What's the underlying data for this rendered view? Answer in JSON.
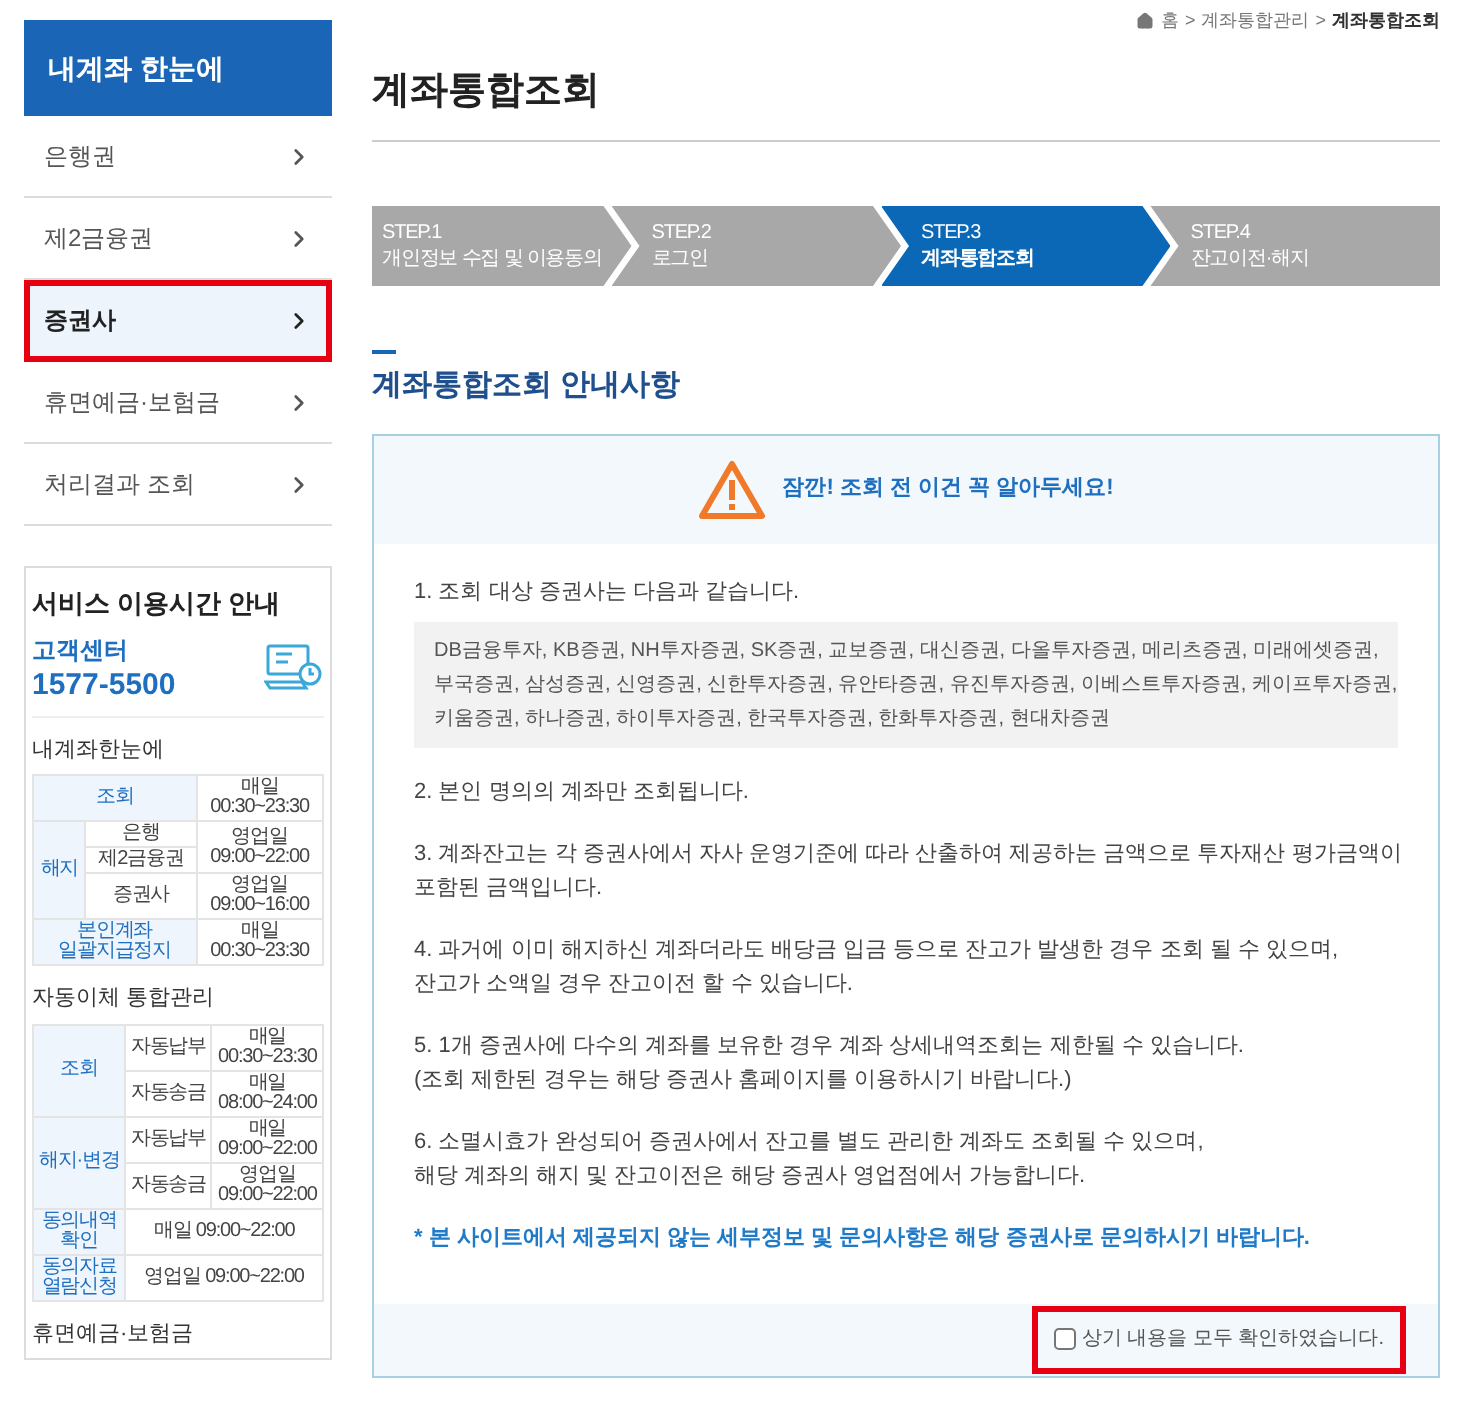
{
  "breadcrumb": [
    {
      "label": "홈",
      "current": false
    },
    {
      "separator": ">",
      "label": "계좌통합관리",
      "current": false
    },
    {
      "separator": ">",
      "label": "계좌통합조회",
      "current": true
    }
  ],
  "sidebar": {
    "title": "내계좌 한눈에",
    "items": [
      {
        "label": "은행권",
        "selected": false,
        "highlighted": false
      },
      {
        "label": "제2금융권",
        "selected": false,
        "highlighted": false
      },
      {
        "label": "증권사",
        "selected": true,
        "highlighted": true
      },
      {
        "label": "휴면예금·보험금",
        "selected": false,
        "highlighted": false
      },
      {
        "label": "처리결과 조회",
        "selected": false,
        "highlighted": false
      }
    ]
  },
  "service_hours": {
    "title": "서비스 이용시간 안내",
    "center_label": "고객센터",
    "center_phone": "1577-5500",
    "sections": [
      {
        "title": "내계좌한눈에",
        "rows": [
          [
            {
              "text": "조회",
              "kind": "head",
              "colspan": 2
            },
            {
              "text": "매일\n00:30~23:30",
              "kind": "value"
            }
          ],
          [
            {
              "text": "해지",
              "kind": "head",
              "rowspan": 3
            },
            {
              "text": "은행",
              "kind": "sub"
            },
            {
              "text": "영업일\n09:00~22:00",
              "kind": "value",
              "rowspan": 2
            }
          ],
          [
            {
              "text": "제2금융권",
              "kind": "sub"
            }
          ],
          [
            {
              "text": "증권사",
              "kind": "sub"
            },
            {
              "text": "영업일\n09:00~16:00",
              "kind": "value"
            }
          ],
          [
            {
              "text": "본인계좌\n일괄지급정지",
              "kind": "head",
              "colspan": 2
            },
            {
              "text": "매일\n00:30~23:30",
              "kind": "value"
            }
          ]
        ]
      },
      {
        "title": "자동이체 통합관리",
        "rows": [
          [
            {
              "text": "조회",
              "kind": "head",
              "rowspan": 2
            },
            {
              "text": "자동납부",
              "kind": "sub"
            },
            {
              "text": "매일\n00:30~23:30",
              "kind": "value"
            }
          ],
          [
            {
              "text": "자동송금",
              "kind": "sub"
            },
            {
              "text": "매일\n08:00~24:00",
              "kind": "value"
            }
          ],
          [
            {
              "text": "해지·변경",
              "kind": "head",
              "rowspan": 2
            },
            {
              "text": "자동납부",
              "kind": "sub"
            },
            {
              "text": "매일\n09:00~22:00",
              "kind": "value"
            }
          ],
          [
            {
              "text": "자동송금",
              "kind": "sub"
            },
            {
              "text": "영업일\n09:00~22:00",
              "kind": "value"
            }
          ],
          [
            {
              "text": "동의내역\n확인",
              "kind": "head"
            },
            {
              "text": "매일 09:00~22:00",
              "kind": "value",
              "colspan": 2
            }
          ],
          [
            {
              "text": "동의자료\n열람신청",
              "kind": "head"
            },
            {
              "text": "영업일 09:00~22:00",
              "kind": "value",
              "colspan": 2
            }
          ]
        ]
      },
      {
        "title": "휴면예금·보험금"
      }
    ]
  },
  "page_title": "계좌통합조회",
  "steps": [
    {
      "number": "STEP.1",
      "label": "개인정보 수집 및 이용동의",
      "selected": false
    },
    {
      "number": "STEP.2",
      "label": "로그인",
      "selected": false
    },
    {
      "number": "STEP.3",
      "label": "계좌통합조회",
      "selected": true
    },
    {
      "number": "STEP.4",
      "label": "잔고이전·해지",
      "selected": false
    }
  ],
  "section_title": "계좌통합조회 안내사항",
  "notice": {
    "alert": "잠깐! 조회 전 이건 꼭 알아두세요!",
    "items": [
      {
        "lines": [
          "1. 조회 대상 증권사는 다음과 같습니다."
        ],
        "companies": [
          "DB금융투자, KB증권, NH투자증권, SK증권, 교보증권, 대신증권, 다올투자증권, 메리츠증권, 미래에셋증권,",
          "부국증권, 삼성증권, 신영증권, 신한투자증권, 유안타증권, 유진투자증권, 이베스트투자증권, 케이프투자증권,",
          "키움증권, 하나증권, 하이투자증권, 한국투자증권, 한화투자증권, 현대차증권"
        ]
      },
      {
        "lines": [
          "2. 본인 명의의 계좌만 조회됩니다."
        ]
      },
      {
        "lines": [
          "3. 계좌잔고는 각 증권사에서 자사 운영기준에 따라 산출하여 제공하는 금액으로 투자재산 평가금액이",
          "포함된 금액입니다."
        ]
      },
      {
        "lines": [
          "4. 과거에 이미 해지하신 계좌더라도 배당금 입금 등으로 잔고가 발생한 경우 조회 될 수 있으며,",
          "잔고가 소액일 경우 잔고이전 할 수 있습니다."
        ]
      },
      {
        "lines": [
          "5. 1개 증권사에 다수의 계좌를 보유한 경우 계좌 상세내역조회는 제한될 수 있습니다.",
          "(조회 제한된 경우는 해당 증권사 홈페이지를 이용하시기 바랍니다.)"
        ]
      },
      {
        "lines": [
          "6. 소멸시효가 완성되어 증권사에서 잔고를 별도 관리한 계좌도 조회될 수 있으며,",
          "해당 계좌의 해지 및 잔고이전은 해당 증권사 영업점에서 가능합니다."
        ]
      }
    ],
    "note": "* 본 사이트에서 제공되지 않는 세부정보 및 문의사항은 해당 증권사로 문의하시기 바랍니다."
  },
  "confirm": {
    "label": "상기 내용을 모두 확인하였습니다.",
    "checked": false,
    "highlighted": true
  }
}
